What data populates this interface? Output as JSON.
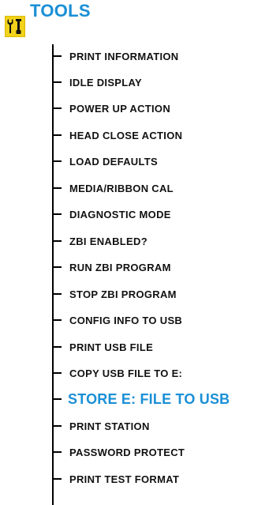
{
  "header": {
    "icon": "tools-icon",
    "title": "TOOLS"
  },
  "menu": {
    "items": [
      {
        "label": "PRINT INFORMATION"
      },
      {
        "label": "IDLE DISPLAY"
      },
      {
        "label": "POWER UP ACTION"
      },
      {
        "label": "HEAD CLOSE ACTION"
      },
      {
        "label": "LOAD DEFAULTS"
      },
      {
        "label": "MEDIA/RIBBON CAL"
      },
      {
        "label": "DIAGNOSTIC MODE"
      },
      {
        "label": "ZBI ENABLED?"
      },
      {
        "label": "RUN ZBI PROGRAM"
      },
      {
        "label": "STOP ZBI PROGRAM"
      },
      {
        "label": "CONFIG INFO TO USB"
      },
      {
        "label": "PRINT USB FILE"
      },
      {
        "label": "COPY USB FILE TO E:"
      },
      {
        "label": "STORE E: FILE TO USB"
      },
      {
        "label": "PRINT STATION"
      },
      {
        "label": "PASSWORD PROTECT"
      },
      {
        "label": "PRINT TEST FORMAT"
      }
    ],
    "selected_label": "STORE E: FILE TO USB"
  },
  "colors": {
    "accent": "#1a8fd6",
    "icon_background": "#f2d21a",
    "text": "#111111"
  }
}
